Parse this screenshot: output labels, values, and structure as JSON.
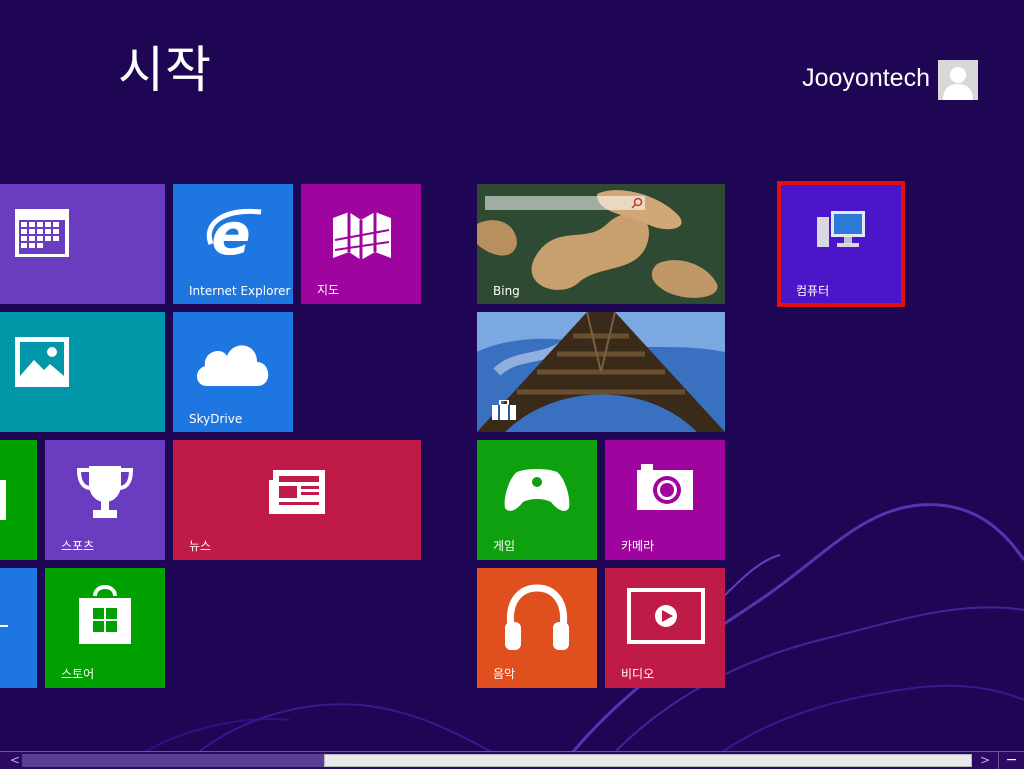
{
  "start": {
    "title": "시작"
  },
  "user": {
    "name": "Jooyontech",
    "avatar_icon": "user-silhouette-icon"
  },
  "tiles": {
    "calendar": {
      "label": "",
      "color": "#6a3cc0",
      "icon": "calendar-icon"
    },
    "ie": {
      "label": "Internet Explorer",
      "color": "#1e77e0",
      "icon": "internet-explorer-icon"
    },
    "maps": {
      "label": "지도",
      "color": "#a0049e",
      "icon": "map-icon"
    },
    "photos": {
      "label": "",
      "color": "#0097a8",
      "icon": "photos-icon"
    },
    "skydrive": {
      "label": "SkyDrive",
      "color": "#1e77e0",
      "icon": "cloud-icon"
    },
    "people": {
      "label": "",
      "color": "#00a000",
      "icon": "people-icon"
    },
    "sports": {
      "label": "스포츠",
      "color": "#6a3cc0",
      "icon": "trophy-icon"
    },
    "news": {
      "label": "뉴스",
      "color": "#c01a48",
      "icon": "news-icon"
    },
    "desktop": {
      "label": "",
      "color": "#1e77e0",
      "icon": "desktop-icon"
    },
    "store": {
      "label": "스토어",
      "color": "#00a000",
      "icon": "store-icon"
    },
    "bing": {
      "label": "Bing",
      "color": "#3a5a40",
      "icon": "search-icon"
    },
    "travel": {
      "label": "",
      "color": "#2a5aa0",
      "icon": "suitcase-icon"
    },
    "games": {
      "label": "게임",
      "color": "#0fa00f",
      "icon": "xbox-controller-icon"
    },
    "camera": {
      "label": "카메라",
      "color": "#a0049e",
      "icon": "camera-icon"
    },
    "music": {
      "label": "음악",
      "color": "#e0501e",
      "icon": "headphones-icon"
    },
    "video": {
      "label": "비디오",
      "color": "#c01a48",
      "icon": "video-play-icon"
    },
    "computer": {
      "label": "컴퓨터",
      "color": "#4a16c8",
      "highlight": "#e01010",
      "icon": "computer-icon"
    }
  },
  "scrollbar": {
    "left_arrow": "<",
    "right_arrow": ">",
    "zoom": "−"
  }
}
